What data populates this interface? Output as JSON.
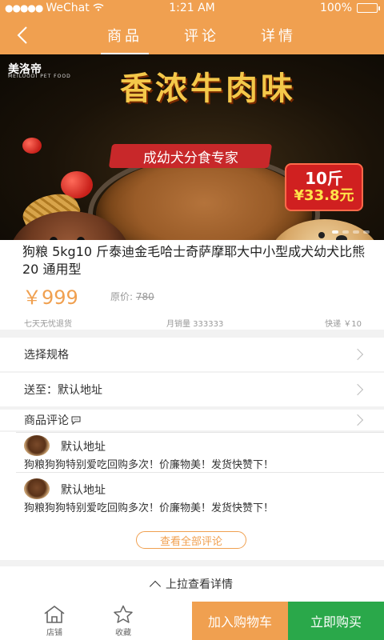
{
  "status_bar": {
    "carrier": "WeChat",
    "time": "1:21 AM",
    "battery": "100%",
    "battery_level": 1.0
  },
  "nav": {
    "tabs": [
      {
        "label": "商品",
        "active": true
      },
      {
        "label": "评论",
        "active": false
      },
      {
        "label": "详情",
        "active": false
      }
    ]
  },
  "banner": {
    "brand": "美洛帝",
    "brand_sub": "MEILUODI PET FOOD",
    "headline": "香浓牛肉味",
    "subheadline": "成幼犬分食专家",
    "badge_weight": "10斤",
    "badge_price": "¥33.8元",
    "slide_count": 4,
    "active_slide": 1
  },
  "product": {
    "title": "狗粮 5kg10 斤泰迪金毛哈士奇萨摩耶大中小型成犬幼犬比熊 20 通用型",
    "price": "￥999",
    "orig_label": "原价:",
    "orig_value": "780",
    "meta_return": "七天无忧退货",
    "meta_sales": "月销量 333333",
    "meta_shipping": "快递 ￥10"
  },
  "options": {
    "spec_label": "选择规格",
    "ship_label": "送至：默认地址",
    "reviews_label": "商品评论"
  },
  "reviews": {
    "items": [
      {
        "name": "默认地址",
        "text": "狗粮狗狗特别爱吃回购多次！价廉物美！发货快赞下！"
      },
      {
        "name": "默认地址",
        "text": "狗粮狗狗特别爱吃回购多次！价廉物美！发货快赞下！"
      }
    ],
    "view_all": "查看全部评论"
  },
  "pull_up": "上拉查看详情",
  "bottom": {
    "shop": "店铺",
    "favorite": "收藏",
    "add_cart": "加入购物车",
    "buy_now": "立即购买"
  },
  "colors": {
    "accent": "#f0a050",
    "buy": "#2aa84a"
  }
}
